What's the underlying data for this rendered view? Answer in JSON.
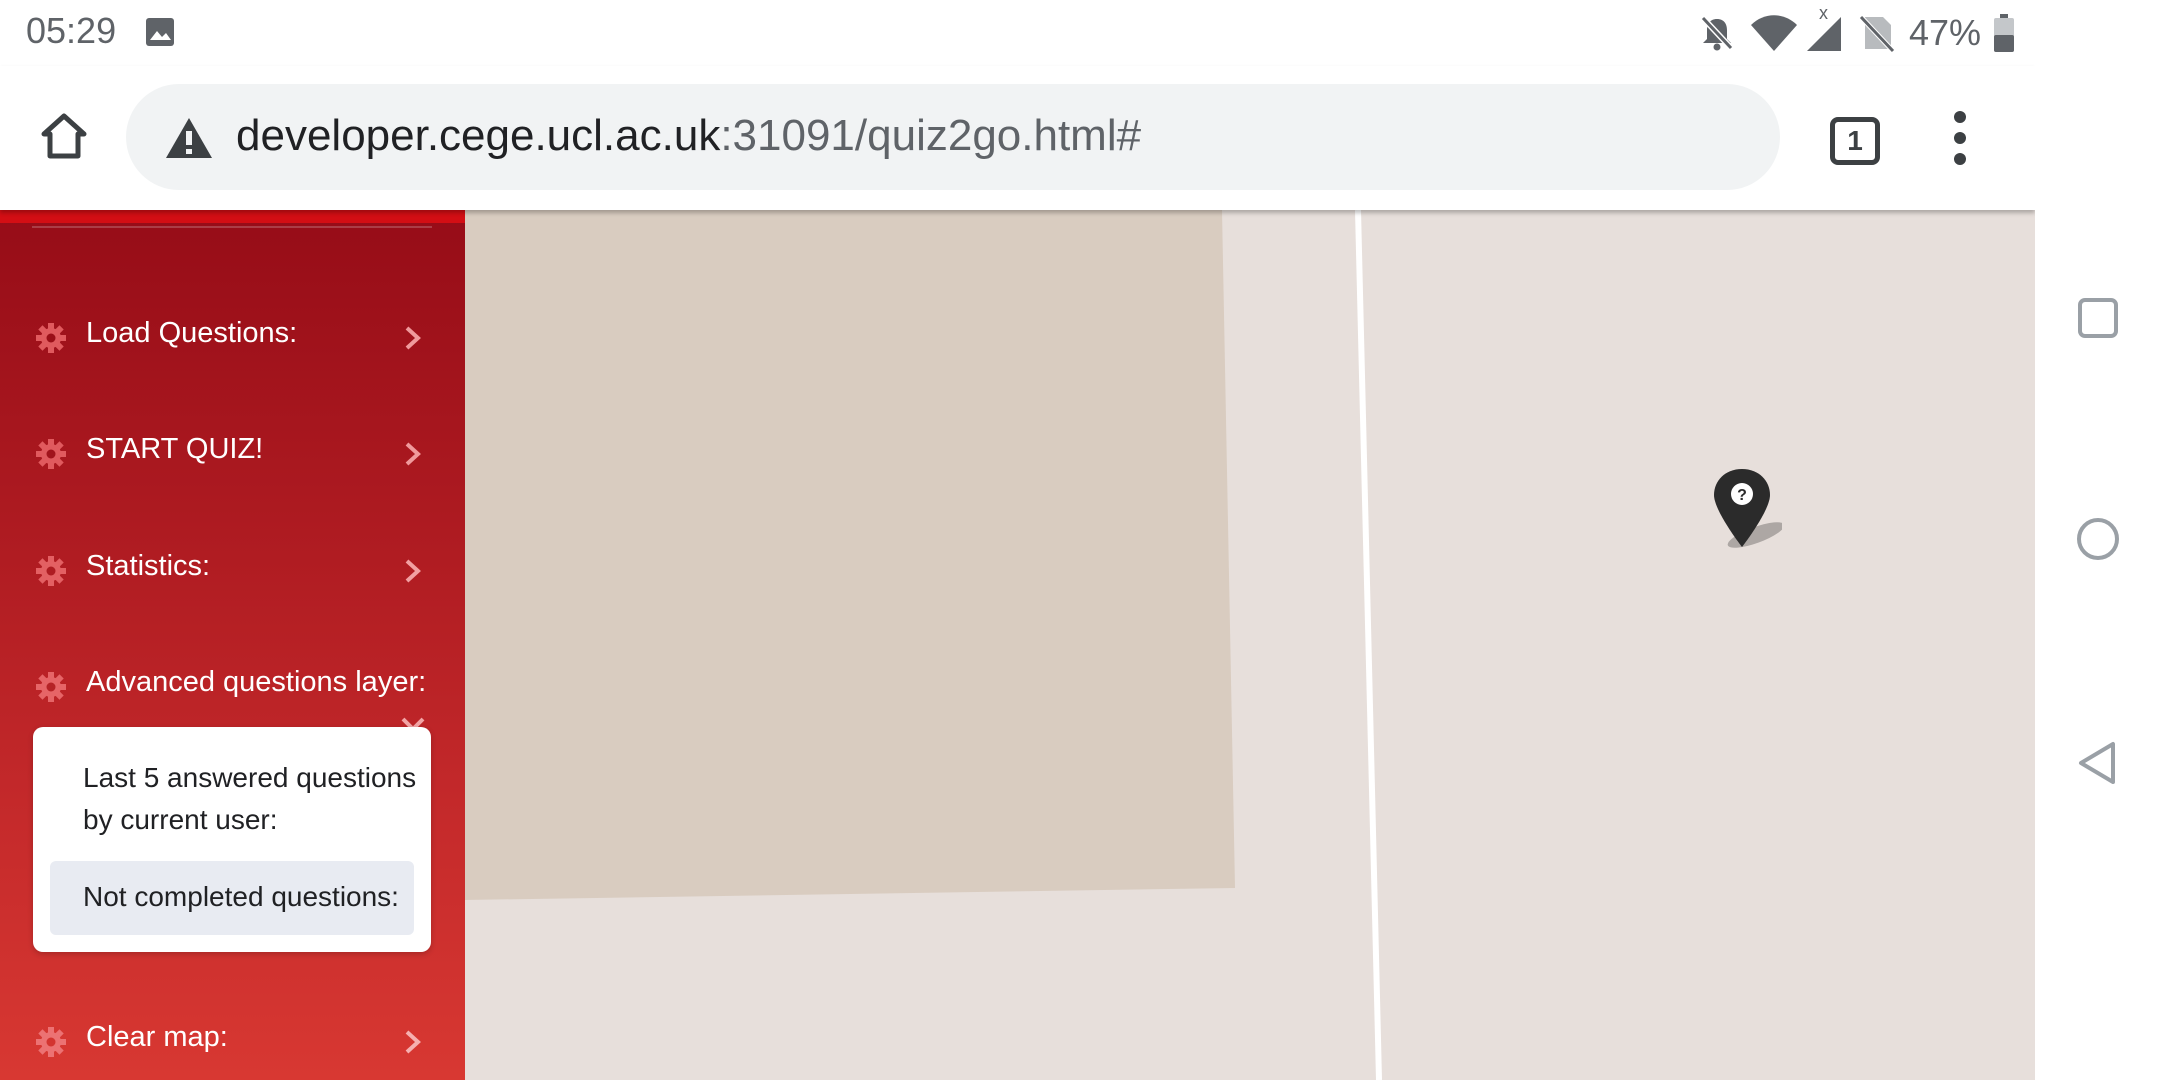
{
  "status_bar": {
    "time": "05:29",
    "battery_percent": "47%",
    "icons": [
      "gallery-icon",
      "notifications-off-icon",
      "wifi-icon",
      "cellular-icon",
      "sim-disabled-icon",
      "battery-icon"
    ],
    "signal_badge": "x"
  },
  "browser": {
    "url_host": "developer.cege.ucl.ac.uk",
    "url_path": ":31091/quiz2go.html#",
    "tab_count": "1",
    "security_icon": "warning-icon"
  },
  "sidebar": {
    "accent_color": "#d30e14",
    "items": [
      {
        "label": "Load Questions:",
        "icon": "gear-icon"
      },
      {
        "label": "START QUIZ!",
        "icon": "gear-icon"
      },
      {
        "label": "Statistics:",
        "icon": "gear-icon"
      },
      {
        "label": "Advanced questions layer:",
        "icon": "gear-icon",
        "expanded": true
      },
      {
        "label": "Clear map:",
        "icon": "gear-icon"
      }
    ],
    "submenu": [
      {
        "label": "Last 5 answered questions by current user:"
      },
      {
        "label": "Not completed questions:",
        "highlighted": true
      }
    ]
  },
  "map": {
    "marker_icon": "question-marker-icon",
    "marker_glyph": "?"
  }
}
